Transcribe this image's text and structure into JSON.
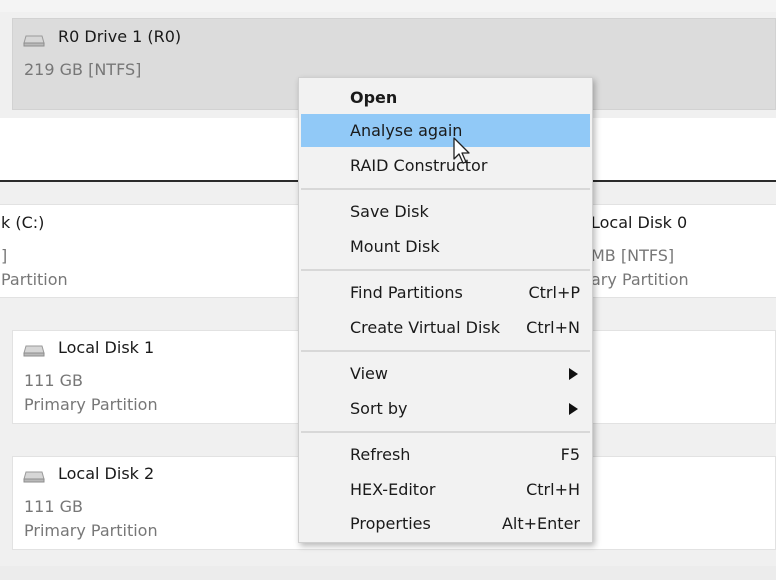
{
  "disks": [
    {
      "name": "R0 Drive 1 (R0)",
      "size": "219 GB [NTFS]",
      "type": ""
    },
    {
      "name": "k (C:)",
      "size": "]",
      "type": "Partition"
    },
    {
      "name": "Local Disk 0",
      "size": "MB [NTFS]",
      "type": "ary Partition"
    },
    {
      "name": "Local Disk 1",
      "size": "111 GB",
      "type": "Primary Partition"
    },
    {
      "name": "Local Disk 2",
      "size": "111 GB",
      "type": "Primary Partition"
    }
  ],
  "context_menu": {
    "open": "Open",
    "analyse_again": "Analyse again",
    "raid_constructor": "RAID Constructor",
    "save_disk": "Save Disk",
    "mount_disk": "Mount Disk",
    "find_partitions": {
      "label": "Find Partitions",
      "shortcut": "Ctrl+P"
    },
    "create_virtual_disk": {
      "label": "Create Virtual Disk",
      "shortcut": "Ctrl+N"
    },
    "view": "View",
    "sort_by": "Sort by",
    "refresh": {
      "label": "Refresh",
      "shortcut": "F5"
    },
    "hex_editor": {
      "label": "HEX-Editor",
      "shortcut": "Ctrl+H"
    },
    "properties": {
      "label": "Properties",
      "shortcut": "Alt+Enter"
    }
  },
  "colors": {
    "highlight": "#91c9f7",
    "selected_card": "#dcdcdc"
  },
  "icons": {
    "drive": "hard-drive-icon",
    "submenu": "chevron-right-icon",
    "pointer": "mouse-pointer-icon"
  }
}
